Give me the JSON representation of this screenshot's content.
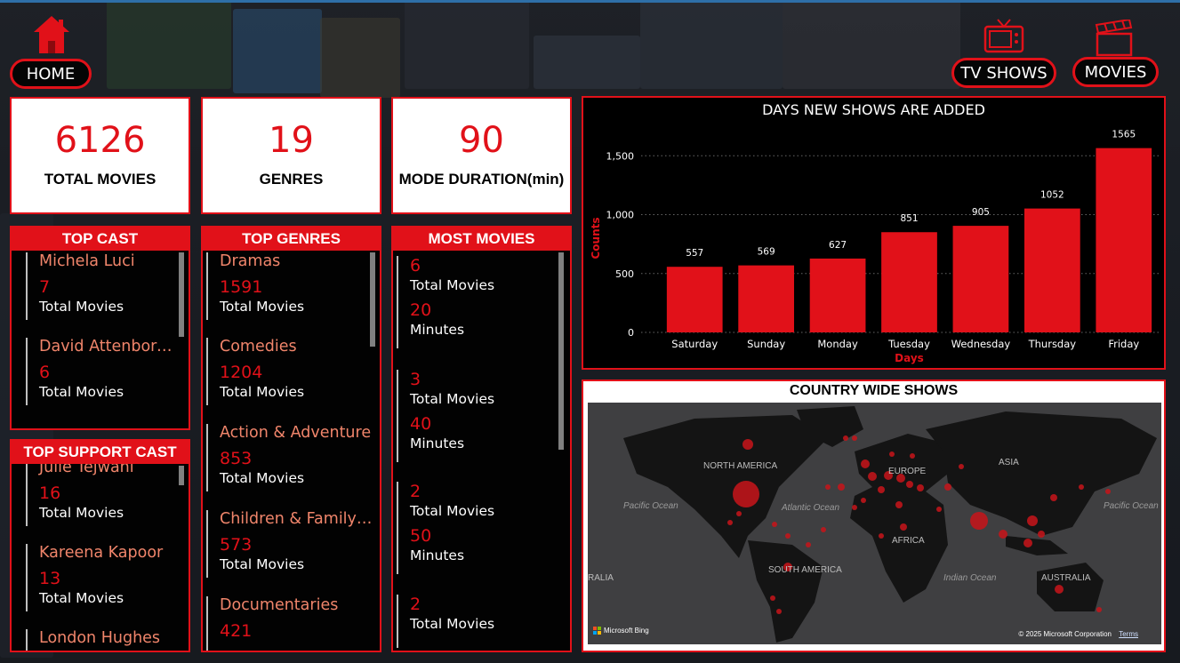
{
  "nav": {
    "home_label": "HOME",
    "tvshows_label": "TV SHOWS",
    "movies_label": "MOVIES"
  },
  "kpis": [
    {
      "value": "6126",
      "label": "TOTAL MOVIES"
    },
    {
      "value": "19",
      "label": "GENRES"
    },
    {
      "value": "90",
      "label": "MODE DURATION(min)"
    }
  ],
  "top_cast": {
    "title": "TOP CAST",
    "items": [
      {
        "name": "Michela Luci",
        "count": "7",
        "sub": "Total Movies"
      },
      {
        "name": "David Attenborough",
        "count": "6",
        "sub": "Total Movies"
      }
    ]
  },
  "top_support_cast": {
    "title": "TOP SUPPORT CAST",
    "items": [
      {
        "name": "Julie Tejwani",
        "count": "16",
        "sub": "Total Movies"
      },
      {
        "name": "Kareena Kapoor",
        "count": "13",
        "sub": "Total Movies"
      },
      {
        "name": "London Hughes",
        "count": "",
        "sub": ""
      }
    ]
  },
  "top_genres": {
    "title": "TOP GENRES",
    "items": [
      {
        "name": "Dramas",
        "count": "1591",
        "sub": "Total Movies"
      },
      {
        "name": "Comedies",
        "count": "1204",
        "sub": "Total Movies"
      },
      {
        "name": "Action & Adventure",
        "count": "853",
        "sub": "Total Movies"
      },
      {
        "name": "Children & Family Movies",
        "count": "573",
        "sub": "Total Movies"
      },
      {
        "name": "Documentaries",
        "count": "421",
        "sub": ""
      }
    ]
  },
  "most_movies": {
    "title": "MOST MOVIES",
    "items": [
      {
        "count": "6",
        "sub": "Total Movies",
        "dur": "20",
        "dur_sub": "Minutes"
      },
      {
        "count": "3",
        "sub": "Total Movies",
        "dur": "40",
        "dur_sub": "Minutes"
      },
      {
        "count": "2",
        "sub": "Total Movies",
        "dur": "50",
        "dur_sub": "Minutes"
      },
      {
        "count": "2",
        "sub": "Total Movies",
        "dur": "",
        "dur_sub": ""
      }
    ]
  },
  "chart_data": {
    "type": "bar",
    "title": "DAYS NEW SHOWS ARE ADDED",
    "xlabel": "Days",
    "ylabel": "Counts",
    "categories": [
      "Saturday",
      "Sunday",
      "Monday",
      "Tuesday",
      "Wednesday",
      "Thursday",
      "Friday"
    ],
    "values": [
      557,
      569,
      627,
      851,
      905,
      1052,
      1565
    ],
    "yticks": [
      "0",
      "500",
      "1,000",
      "1,500"
    ],
    "ylim": [
      0,
      1600
    ],
    "grid": true,
    "bar_color": "#e11119"
  },
  "map": {
    "title": "COUNTRY WIDE SHOWS",
    "labels": {
      "north_america": "NORTH AMERICA",
      "europe": "EUROPE",
      "asia": "ASIA",
      "africa": "AFRICA",
      "south_america": "SOUTH AMERICA",
      "australia": "AUSTRALIA",
      "pacific_left": "Pacific Ocean",
      "pacific_right": "Pacific Ocean",
      "atlantic": "Atlantic Ocean",
      "indian": "Indian Ocean",
      "ralia": "RALIA"
    },
    "bing": "Microsoft Bing",
    "copyright": "© 2025 Microsoft Corporation",
    "terms": "Terms",
    "bubble_color": "#c8141a"
  },
  "colors": {
    "accent": "#e11119",
    "item_name": "#f0856b"
  }
}
